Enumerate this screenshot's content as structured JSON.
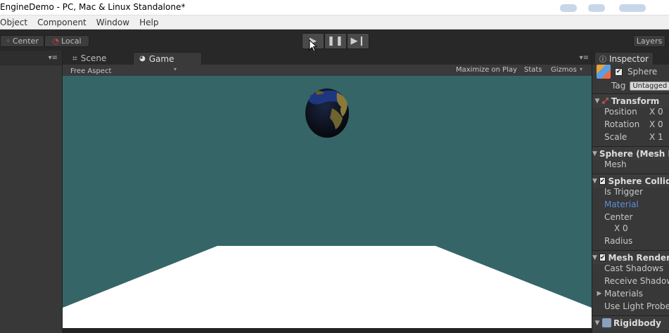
{
  "window": {
    "title": "EngineDemo - PC, Mac & Linux Standalone*"
  },
  "menu": {
    "items": [
      "Object",
      "Component",
      "Window",
      "Help"
    ]
  },
  "toolbar": {
    "center_label": "Center",
    "local_label": "Local",
    "layers_label": "Layers"
  },
  "tabs": {
    "scene": "Scene",
    "game": "Game"
  },
  "game_bar": {
    "aspect": "Free Aspect",
    "maximize": "Maximize on Play",
    "stats": "Stats",
    "gizmos": "Gizmos"
  },
  "inspector": {
    "tab": "Inspector",
    "object_name": "Sphere",
    "tag_label": "Tag",
    "tag_value": "Untagged",
    "transform": {
      "title": "Transform",
      "position_label": "Position",
      "position_x": "X 0",
      "rotation_label": "Rotation",
      "rotation_x": "X 0",
      "scale_label": "Scale",
      "scale_x": "X 1"
    },
    "mesh_filter": {
      "title": "Sphere (Mesh Filter)",
      "mesh_label": "Mesh"
    },
    "collider": {
      "title": "Sphere Collider",
      "is_trigger": "Is Trigger",
      "material": "Material",
      "center": "Center",
      "center_x": "X 0",
      "radius": "Radius"
    },
    "mesh_renderer": {
      "title": "Mesh Renderer",
      "cast_shadows": "Cast Shadows",
      "receive_shadows": "Receive Shadows",
      "materials": "Materials",
      "use_light_probes": "Use Light Probes"
    },
    "rigidbody": {
      "title": "Rigidbody"
    }
  },
  "colors": {
    "viewport_bg": "#356567",
    "floor": "#ffffff",
    "link": "#5b8ed8"
  }
}
